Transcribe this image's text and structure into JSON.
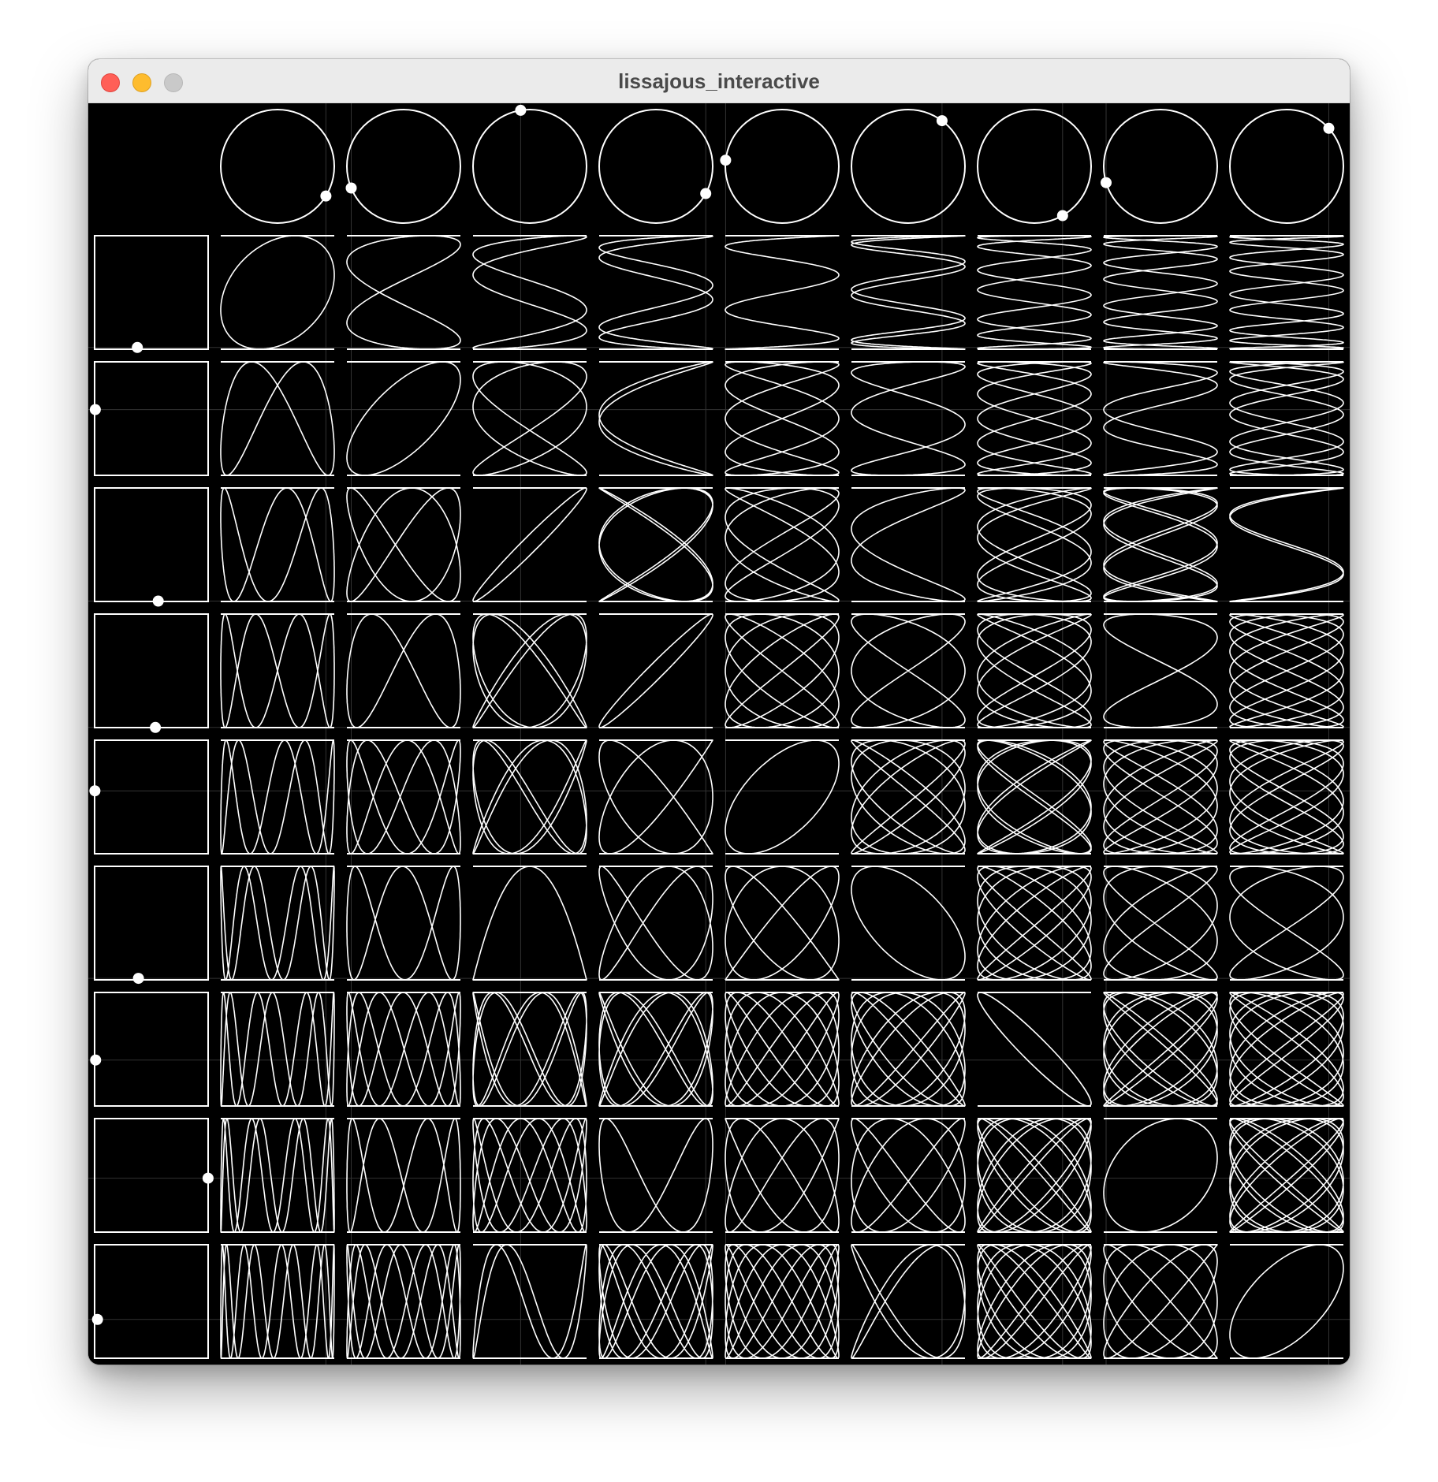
{
  "window": {
    "title": "lissajous_interactive",
    "controls": [
      "close",
      "minimize",
      "zoom"
    ]
  },
  "grid": {
    "columns": 10,
    "rows": 10,
    "background": "#000000",
    "stroke": "#ffffff",
    "guide_color": "#333333",
    "col_frequencies": [
      1,
      2,
      3,
      4,
      5,
      6,
      7,
      8,
      9
    ],
    "row_frequencies": [
      1,
      2,
      3,
      4,
      5,
      6,
      7,
      8,
      9
    ],
    "col_phases": [
      0.1,
      0.42,
      0.0,
      0.12,
      0.5,
      0.85,
      0.3,
      0.6,
      0.9
    ],
    "row_phases": [
      0.05,
      0.3,
      0.72,
      0.9,
      0.4,
      0.25,
      0.6,
      0.15,
      0.8
    ],
    "col_dot_angles": [
      0.55,
      2.75,
      4.55,
      0.5,
      3.25,
      5.35,
      1.05,
      2.85,
      5.55
    ],
    "row_dot_angles": [
      1.82,
      3.3,
      1.45,
      1.5,
      3.25,
      1.8,
      2.95,
      0.05,
      2.82
    ]
  }
}
